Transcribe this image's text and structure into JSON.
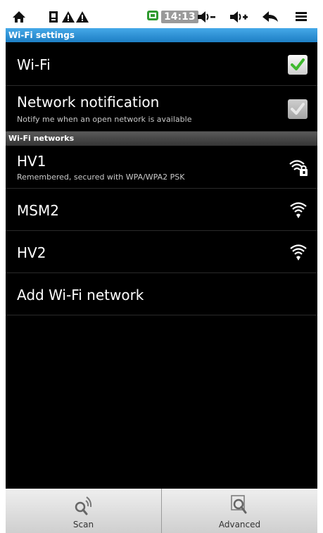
{
  "status_bar": {
    "time": "14:13",
    "icons": [
      "home-icon",
      "sd-card-icon",
      "warning-icon",
      "warning-icon",
      "battery-icon",
      "volume-down-icon",
      "volume-up-icon",
      "back-icon",
      "menu-icon"
    ]
  },
  "sections": {
    "settings_header": "Wi-Fi settings",
    "networks_header": "Wi-Fi networks"
  },
  "settings": {
    "wifi": {
      "title": "Wi-Fi",
      "checked": true
    },
    "notification": {
      "title": "Network notification",
      "subtitle": "Notify me when an open network is available",
      "checked": true,
      "enabled": false
    }
  },
  "networks": [
    {
      "name": "HV1",
      "status": "Remembered, secured with WPA/WPA2 PSK",
      "secured": true
    },
    {
      "name": "MSM2",
      "status": "",
      "secured": false
    },
    {
      "name": "HV2",
      "status": "",
      "secured": false
    }
  ],
  "add_network": {
    "label": "Add Wi-Fi network"
  },
  "menu": {
    "scan": {
      "label": "Scan",
      "icon": "scan-icon"
    },
    "advanced": {
      "label": "Advanced",
      "icon": "advanced-icon"
    }
  },
  "colors": {
    "accent": "#1e7fc4",
    "check_green": "#3fb92f"
  }
}
